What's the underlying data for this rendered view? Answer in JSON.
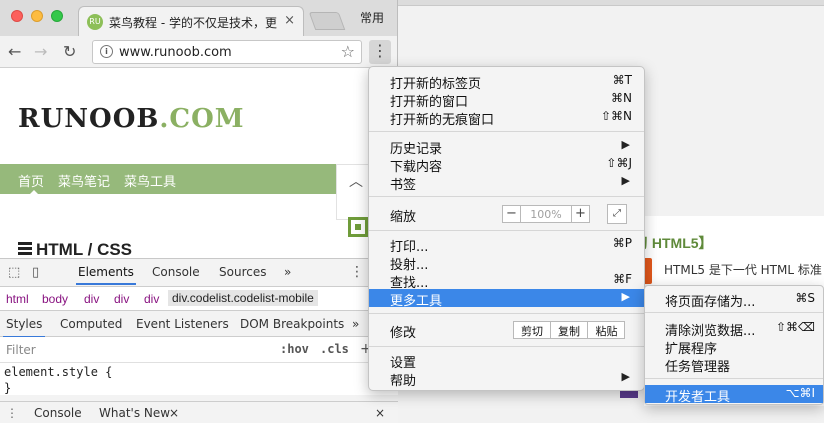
{
  "background_window": {
    "card_heading": "习 HTML5】",
    "card_text": "HTML5 是下一代 HTML 标准"
  },
  "browser": {
    "tab_title": "菜鸟教程 - 学的不仅是技术，更",
    "tab_close": "×",
    "favicon_text": "RU",
    "profile_label": "常用",
    "url": "www.runoob.com",
    "lock_icon_text": "i"
  },
  "page": {
    "logo_main": "RUNOOB",
    "logo_suffix": ".COM",
    "nav": [
      "首页",
      "菜鸟笔记",
      "菜鸟工具"
    ],
    "section_title": "HTML / CSS"
  },
  "devtools": {
    "tabs": [
      "Elements",
      "Console",
      "Sources"
    ],
    "more": "»",
    "breadcrumbs": [
      "html",
      "body",
      "div",
      "div",
      "div"
    ],
    "selected_crumb": "div.codelist.codelist-mobile",
    "subtabs": [
      "Styles",
      "Computed",
      "Event Listeners",
      "DOM Breakpoints"
    ],
    "subtabs_more": "»",
    "filter_placeholder": "Filter",
    "hov": ":hov",
    "cls": ".cls",
    "plus": "+",
    "code_line1": "element.style {",
    "code_line2": "}",
    "drawer_tabs": [
      "Console",
      "What's New"
    ],
    "drawer_close": "×"
  },
  "menu": {
    "items": [
      {
        "label": "打开新的标签页",
        "shortcut": "⌘T"
      },
      {
        "label": "打开新的窗口",
        "shortcut": "⌘N"
      },
      {
        "label": "打开新的无痕窗口",
        "shortcut": "⇧⌘N"
      },
      {
        "label": "历史记录",
        "shortcut": "▶"
      },
      {
        "label": "下载内容",
        "shortcut": "⇧⌘J"
      },
      {
        "label": "书签",
        "shortcut": "▶"
      },
      {
        "label": "缩放",
        "shortcut": ""
      },
      {
        "label": "打印...",
        "shortcut": "⌘P"
      },
      {
        "label": "投射...",
        "shortcut": ""
      },
      {
        "label": "查找...",
        "shortcut": "⌘F"
      },
      {
        "label": "更多工具",
        "shortcut": "▶"
      },
      {
        "label": "修改",
        "shortcut": ""
      },
      {
        "label": "设置",
        "shortcut": ""
      },
      {
        "label": "帮助",
        "shortcut": "▶"
      }
    ],
    "zoom_minus": "−",
    "zoom_value": "100%",
    "zoom_plus": "+",
    "fullscreen": "⤢",
    "edit_cut": "剪切",
    "edit_copy": "复制",
    "edit_paste": "粘贴"
  },
  "submenu": {
    "items": [
      {
        "label": "将页面存储为...",
        "shortcut": "⌘S"
      },
      {
        "label": "清除浏览数据...",
        "shortcut": "⇧⌘⌫"
      },
      {
        "label": "扩展程序",
        "shortcut": ""
      },
      {
        "label": "任务管理器",
        "shortcut": ""
      },
      {
        "label": "开发者工具",
        "shortcut": "⌥⌘I"
      }
    ]
  },
  "colors": {
    "accent": "#3b87e8",
    "nav_green": "#96b97b",
    "logo_green": "#8bb063"
  }
}
